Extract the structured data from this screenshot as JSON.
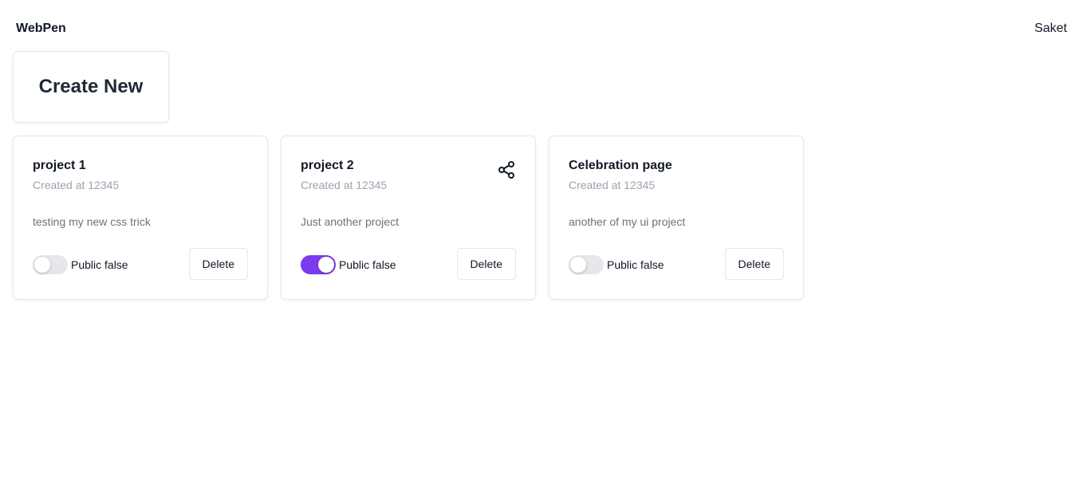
{
  "header": {
    "brand": "WebPen",
    "user": "Saket"
  },
  "create": {
    "label": "Create New"
  },
  "projects": [
    {
      "title": "project 1",
      "created": "Created at 12345",
      "description": "testing my new css trick",
      "public_label": "Public false",
      "public_on": false,
      "delete_label": "Delete"
    },
    {
      "title": "project 2",
      "created": "Created at 12345",
      "description": "Just another project",
      "public_label": "Public false",
      "public_on": true,
      "delete_label": "Delete",
      "share_icon": "share-icon"
    },
    {
      "title": "Celebration page",
      "created": "Created at 12345",
      "description": "another of my ui project",
      "public_label": "Public false",
      "public_on": false,
      "delete_label": "Delete"
    }
  ],
  "colors": {
    "accent": "#7c3aed",
    "toggle_off": "#e5e7eb",
    "border": "#e5e7eb"
  }
}
